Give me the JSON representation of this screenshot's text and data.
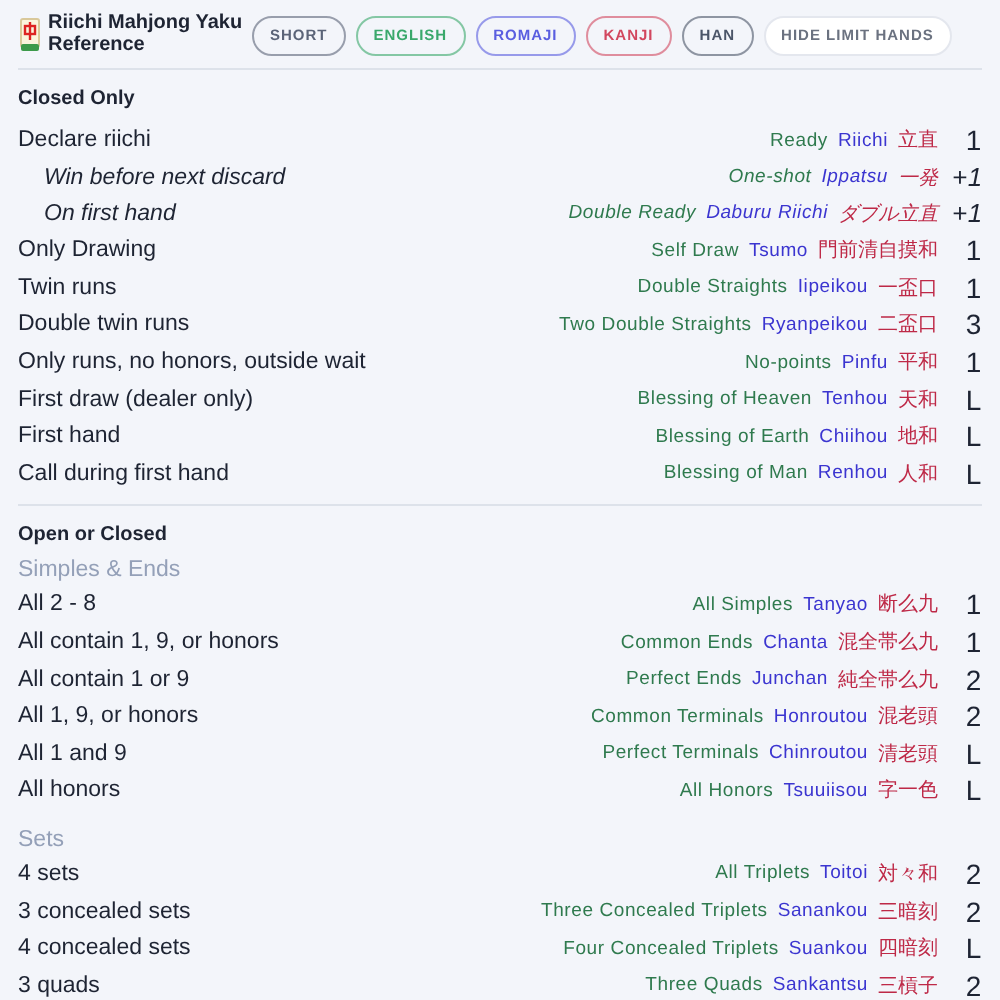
{
  "header": {
    "title": "Riichi Mahjong Yaku Reference",
    "toggles": [
      {
        "label": "SHORT",
        "on": true,
        "color": "#5b6478"
      },
      {
        "label": "ENGLISH",
        "on": true,
        "color": "#3aa86b"
      },
      {
        "label": "ROMAJI",
        "on": true,
        "color": "#5a5ee0"
      },
      {
        "label": "KANJI",
        "on": true,
        "color": "#d2475f"
      },
      {
        "label": "HAN",
        "on": true,
        "color": "#4b5568"
      },
      {
        "label": "HIDE LIMIT HANDS",
        "on": false,
        "color": "#6b7280"
      }
    ]
  },
  "sections": [
    {
      "title": "Closed Only",
      "groups": [
        {
          "rows": [
            {
              "kind": "main",
              "description": "Declare riichi",
              "english": "Ready",
              "romaji": "Riichi",
              "kanji": "立直",
              "han": "1"
            },
            {
              "kind": "sub",
              "description": "Win before next discard",
              "english": "One-shot",
              "romaji": "Ippatsu",
              "kanji": "一発",
              "han": "+1"
            },
            {
              "kind": "sub",
              "description": "On first hand",
              "english": "Double Ready",
              "romaji": "Daburu Riichi",
              "kanji": "ダブル立直",
              "han": "+1"
            },
            {
              "kind": "main",
              "description": "Only Drawing",
              "english": "Self Draw",
              "romaji": "Tsumo",
              "kanji": "門前清自摸和",
              "han": "1"
            },
            {
              "kind": "main",
              "description": "Twin runs",
              "english": "Double Straights",
              "romaji": "Iipeikou",
              "kanji": "一盃口",
              "han": "1"
            },
            {
              "kind": "main",
              "description": "Double twin runs",
              "english": "Two Double Straights",
              "romaji": "Ryanpeikou",
              "kanji": "二盃口",
              "han": "3"
            },
            {
              "kind": "main",
              "description": "Only runs, no honors, outside wait",
              "english": "No-points",
              "romaji": "Pinfu",
              "kanji": "平和",
              "han": "1"
            },
            {
              "kind": "main",
              "description": "First draw (dealer only)",
              "english": "Blessing of Heaven",
              "romaji": "Tenhou",
              "kanji": "天和",
              "han": "L"
            },
            {
              "kind": "main",
              "description": "First hand",
              "english": "Blessing of Earth",
              "romaji": "Chiihou",
              "kanji": "地和",
              "han": "L"
            },
            {
              "kind": "main",
              "description": "Call during first hand",
              "english": "Blessing of Man",
              "romaji": "Renhou",
              "kanji": "人和",
              "han": "L"
            }
          ]
        }
      ]
    },
    {
      "title": "Open or Closed",
      "groups": [
        {
          "title": "Simples & Ends",
          "rows": [
            {
              "kind": "main",
              "description": "All 2 - 8",
              "english": "All Simples",
              "romaji": "Tanyao",
              "kanji": "断么九",
              "han": "1"
            },
            {
              "kind": "main",
              "description": "All contain 1, 9, or honors",
              "english": "Common Ends",
              "romaji": "Chanta",
              "kanji": "混全帯么九",
              "han": "1"
            },
            {
              "kind": "main",
              "description": "All contain 1 or 9",
              "english": "Perfect Ends",
              "romaji": "Junchan",
              "kanji": "純全帯么九",
              "han": "2"
            },
            {
              "kind": "main",
              "description": "All 1, 9, or honors",
              "english": "Common Terminals",
              "romaji": "Honroutou",
              "kanji": "混老頭",
              "han": "2"
            },
            {
              "kind": "main",
              "description": "All 1 and 9",
              "english": "Perfect Terminals",
              "romaji": "Chinroutou",
              "kanji": "清老頭",
              "han": "L"
            },
            {
              "kind": "main",
              "description": "All honors",
              "english": "All Honors",
              "romaji": "Tsuuiisou",
              "kanji": "字一色",
              "han": "L"
            }
          ]
        },
        {
          "title": "Sets",
          "rows": [
            {
              "kind": "main",
              "description": "4 sets",
              "english": "All Triplets",
              "romaji": "Toitoi",
              "kanji": "対々和",
              "han": "2"
            },
            {
              "kind": "main",
              "description": "3 concealed sets",
              "english": "Three Concealed Triplets",
              "romaji": "Sanankou",
              "kanji": "三暗刻",
              "han": "2"
            },
            {
              "kind": "main",
              "description": "4 concealed sets",
              "english": "Four Concealed Triplets",
              "romaji": "Suankou",
              "kanji": "四暗刻",
              "han": "L"
            },
            {
              "kind": "main",
              "description": "3 quads",
              "english": "Three Quads",
              "romaji": "Sankantsu",
              "kanji": "三槓子",
              "han": "2"
            }
          ]
        }
      ]
    }
  ]
}
